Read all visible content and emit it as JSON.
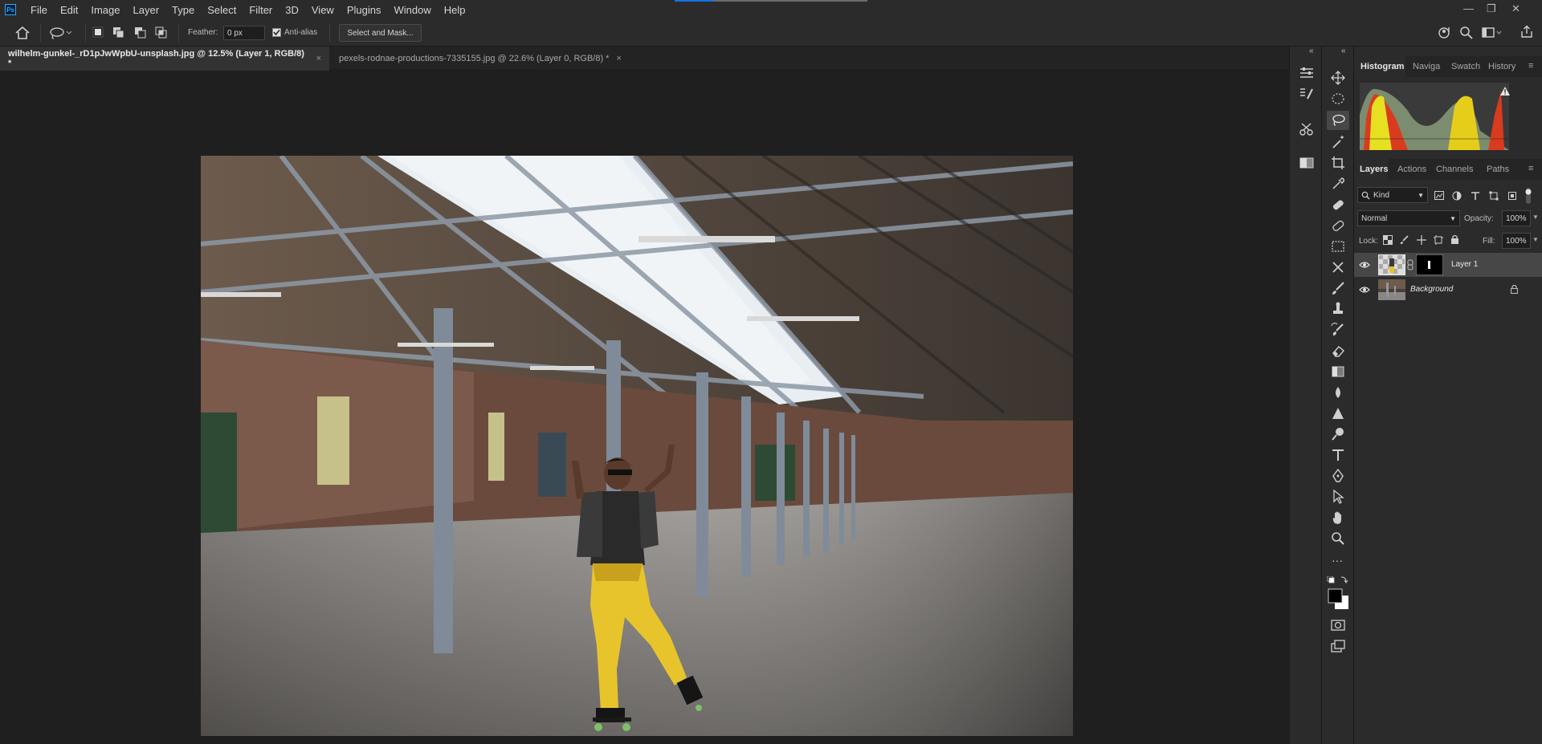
{
  "menu": [
    "File",
    "Edit",
    "Image",
    "Layer",
    "Type",
    "Select",
    "Filter",
    "3D",
    "View",
    "Plugins",
    "Window",
    "Help"
  ],
  "app_logo": "Ps",
  "window_controls": {
    "minimize": "—",
    "restore": "❐",
    "close": "✕"
  },
  "options": {
    "feather_label": "Feather:",
    "feather_value": "0 px",
    "antialias_label": "Anti-alias",
    "antialias_checked": true,
    "select_mask_label": "Select and Mask..."
  },
  "tabs": [
    {
      "label": "wilhelm-gunkel-_rD1pJwWpbU-unsplash.jpg @ 12.5% (Layer 1, RGB/8) *",
      "active": true,
      "close": "×"
    },
    {
      "label": "pexels-rodnae-productions-7335155.jpg @ 22.6% (Layer 0, RGB/8) *",
      "active": false,
      "close": "×"
    }
  ],
  "panel_tabs_top": [
    "Histogram",
    "Naviga",
    "Swatch",
    "History"
  ],
  "panel_tabs_layers": [
    "Layers",
    "Actions",
    "Channels",
    "Paths"
  ],
  "layers_panel": {
    "kind_label": "Kind",
    "blend_mode": "Normal",
    "opacity_label": "Opacity:",
    "opacity_value": "100%",
    "lock_label": "Lock:",
    "fill_label": "Fill:",
    "fill_value": "100%",
    "layers": [
      {
        "name": "Layer 1",
        "visible": true,
        "selected": true,
        "has_mask": true,
        "locked": false
      },
      {
        "name": "Background",
        "visible": true,
        "selected": false,
        "has_mask": false,
        "locked": true
      }
    ]
  },
  "colors": {
    "accent": "#1473e6",
    "panel_bg": "#2b2b2b",
    "canvas_bg": "#1f1f1f",
    "pants_yellow": "#e8c42c"
  }
}
